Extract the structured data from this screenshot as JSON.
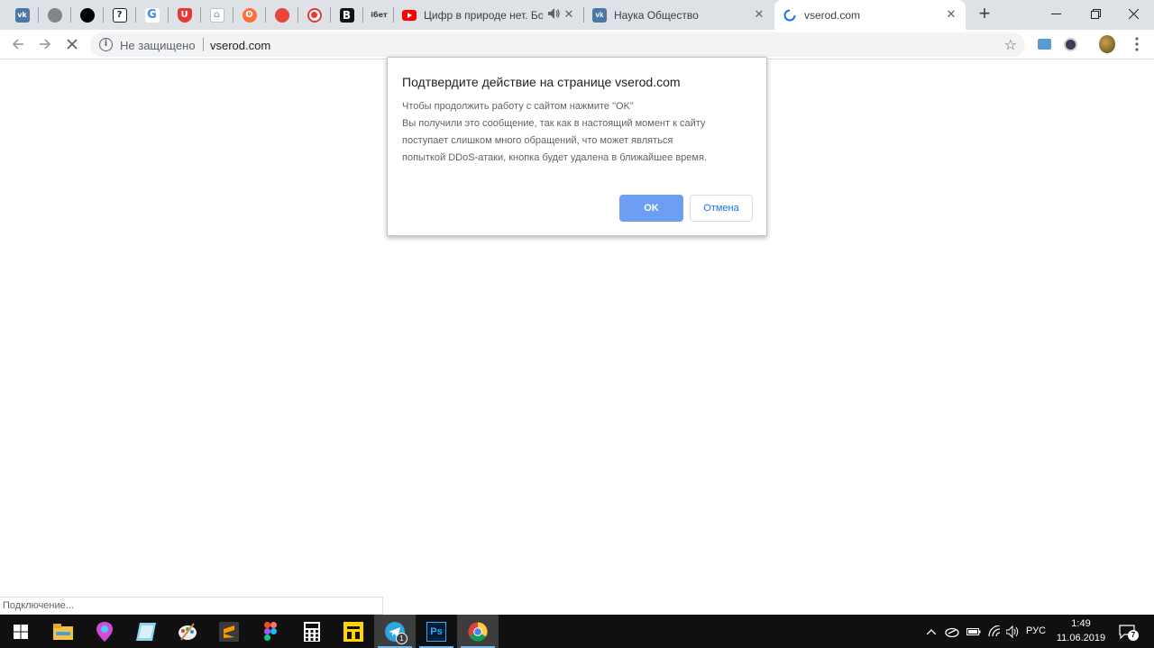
{
  "browser": {
    "pinned_tabs": [
      {
        "icon": "vk-icon",
        "glyph": "vk",
        "color": "#4a76a8"
      },
      {
        "icon": "globe-icon",
        "glyph": "◍",
        "color": "#70757a"
      },
      {
        "icon": "black-circle-icon",
        "glyph": "●",
        "color": "#000000"
      },
      {
        "icon": "question-icon",
        "glyph": "?",
        "color": "#202124"
      },
      {
        "icon": "google-icon",
        "glyph": "G",
        "color": "#4285f4"
      },
      {
        "icon": "shield-icon",
        "glyph": "U",
        "color": "#e53935"
      },
      {
        "icon": "hat-icon",
        "glyph": "⌂",
        "color": "#9aa0a6"
      },
      {
        "icon": "bear-icon",
        "glyph": "ʘ",
        "color": "#ff6d3a"
      },
      {
        "icon": "chat-icon",
        "glyph": "●",
        "color": "#e8453c"
      },
      {
        "icon": "record-icon",
        "glyph": "◉",
        "color": "#e53935"
      },
      {
        "icon": "b-icon",
        "glyph": "B",
        "color": "#111111"
      },
      {
        "icon": "ibet-icon",
        "glyph": "iбет",
        "color": "#5f6368"
      }
    ],
    "tabs": [
      {
        "title": "Цифр в природе нет. Бол",
        "audio": "🔊"
      },
      {
        "title": "Наука Общество"
      },
      {
        "title": "vserod.com"
      }
    ],
    "new_tab": "+",
    "window_controls": {
      "minimize": "—",
      "restore": "❐",
      "close": "✕"
    },
    "omnibox": {
      "security_text": "Не защищено",
      "url": "vserod.com"
    }
  },
  "dialog": {
    "title": "Подтвердите действие на странице vserod.com",
    "message_lines": [
      "Чтобы продолжить работу с сайтом нажмите \"OK\"",
      "Вы получили это сообщение, так как в настоящий момент к сайту",
      "поступает слишком много обращений, что может являться",
      "попыткой DDoS-атаки, кнопка будет удалена в ближайшее время."
    ],
    "ok_label": "OK",
    "cancel_label": "Отмена"
  },
  "status_bar": {
    "text": "Подключение..."
  },
  "taskbar": {
    "apps": [
      "start-icon",
      "file-explorer-icon",
      "maps-pin-icon",
      "notes-app-icon",
      "paint-app-icon",
      "sublime-text-icon",
      "figma-icon",
      "calculator-icon",
      "yellow-app-icon",
      "telegram-icon",
      "photoshop-icon",
      "chrome-icon"
    ],
    "telegram_badge": "1",
    "photoshop_label": "Ps",
    "language": "РУС",
    "time": "1:49",
    "date": "11.06.2019",
    "notifications_count": "7"
  }
}
